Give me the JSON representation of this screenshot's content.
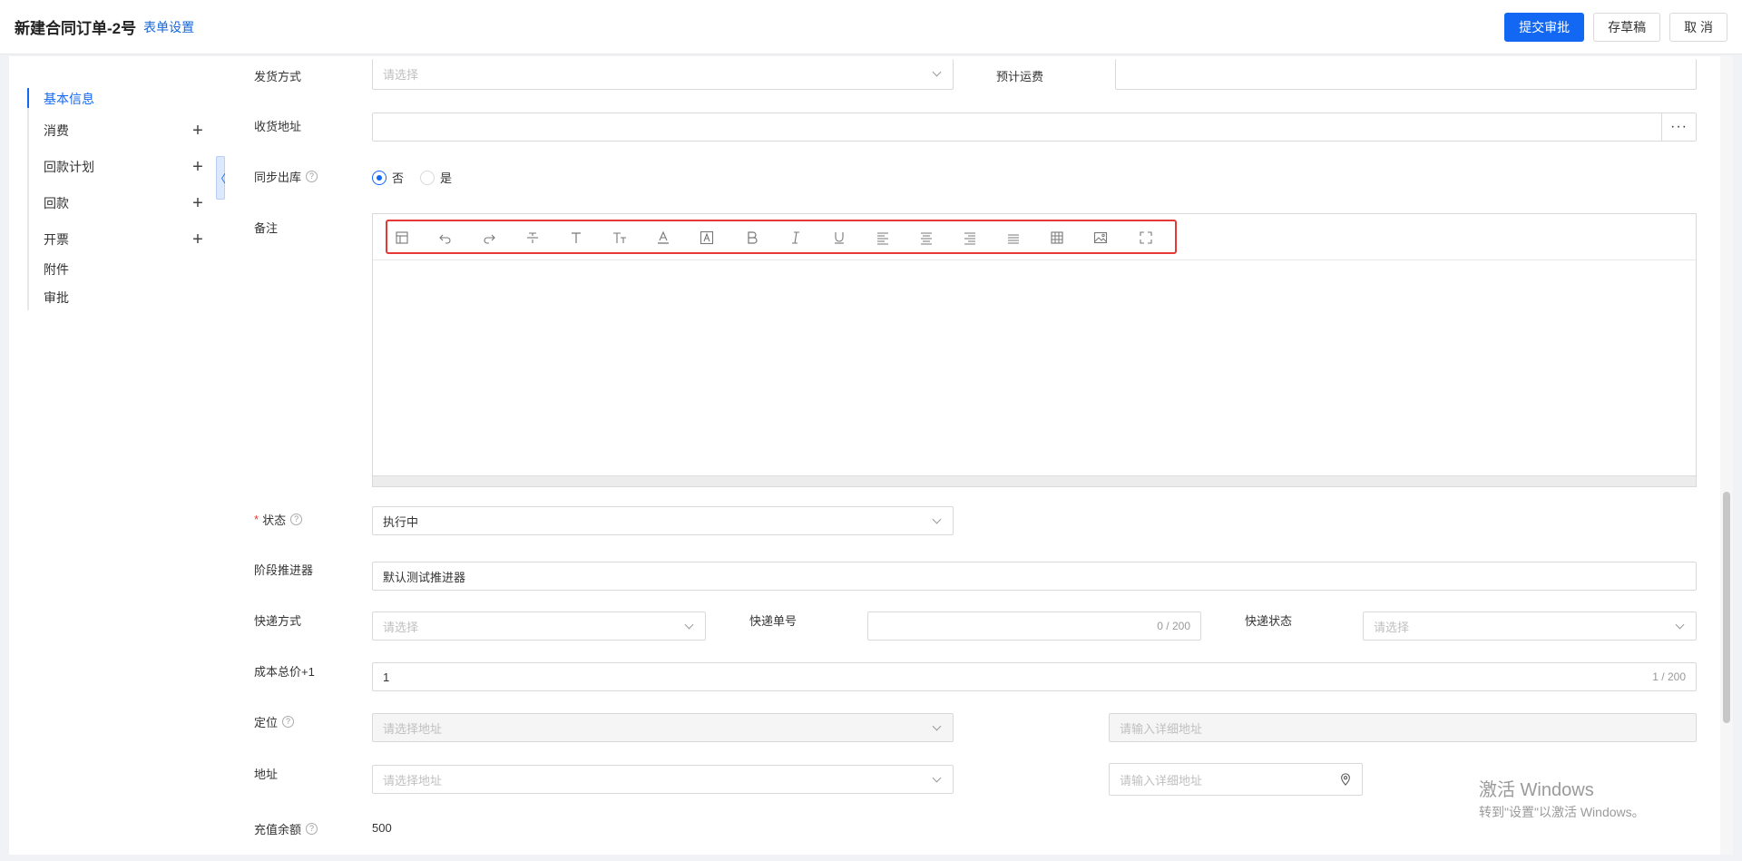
{
  "header": {
    "title": "新建合同订单-2号",
    "settings_link": "表单设置",
    "submit_label": "提交审批",
    "draft_label": "存草稿",
    "cancel_label": "取 消"
  },
  "sidebar": {
    "items": [
      {
        "label": "基本信息",
        "active": true
      },
      {
        "label": "消费",
        "has_add": true
      },
      {
        "label": "回款计划",
        "has_add": true
      },
      {
        "label": "回款",
        "has_add": true
      },
      {
        "label": "开票",
        "has_add": true
      },
      {
        "label": "附件"
      },
      {
        "label": "审批"
      }
    ],
    "plus_symbol": "+",
    "collapse_symbol": "〈"
  },
  "form": {
    "shipping_method": {
      "label": "发货方式",
      "placeholder": "请选择"
    },
    "estimated_freight": {
      "label": "预计运费",
      "value": ""
    },
    "delivery_address": {
      "label": "收货地址",
      "value": "",
      "more_symbol": "···"
    },
    "sync_outbound": {
      "label": "同步出库",
      "options": [
        "否",
        "是"
      ],
      "selected": "否"
    },
    "remarks": {
      "label": "备注",
      "toolbar_icons": [
        "template-icon",
        "undo-icon",
        "redo-icon",
        "strikethrough-icon",
        "font-family-icon",
        "font-size-icon",
        "font-color-icon",
        "background-color-icon",
        "bold-icon",
        "italic-icon",
        "underline-icon",
        "align-left-icon",
        "align-center-icon",
        "align-right-icon",
        "justify-icon",
        "table-icon",
        "image-icon",
        "fullscreen-icon"
      ]
    },
    "status": {
      "label": "状态",
      "required": true,
      "value": "执行中"
    },
    "stage_promoter": {
      "label": "阶段推进器",
      "value": "默认测试推进器"
    },
    "express_method": {
      "label": "快递方式",
      "placeholder": "请选择"
    },
    "express_number": {
      "label": "快递单号",
      "count": "0 / 200"
    },
    "express_status": {
      "label": "快递状态",
      "placeholder": "请选择"
    },
    "cost_total": {
      "label": "成本总价+1",
      "value": "1",
      "count": "1 / 200"
    },
    "location": {
      "label": "定位",
      "address_placeholder": "请选择地址",
      "detail_placeholder": "请输入详细地址"
    },
    "address": {
      "label": "地址",
      "address_placeholder": "请选择地址",
      "detail_placeholder": "请输入详细地址"
    },
    "recharge_balance": {
      "label": "充值余额",
      "value": "500"
    }
  },
  "watermark": {
    "line1": "激活 Windows",
    "line2": "转到\"设置\"以激活 Windows。"
  },
  "colors": {
    "primary": "#1268f3",
    "highlight_border": "#e53935"
  }
}
